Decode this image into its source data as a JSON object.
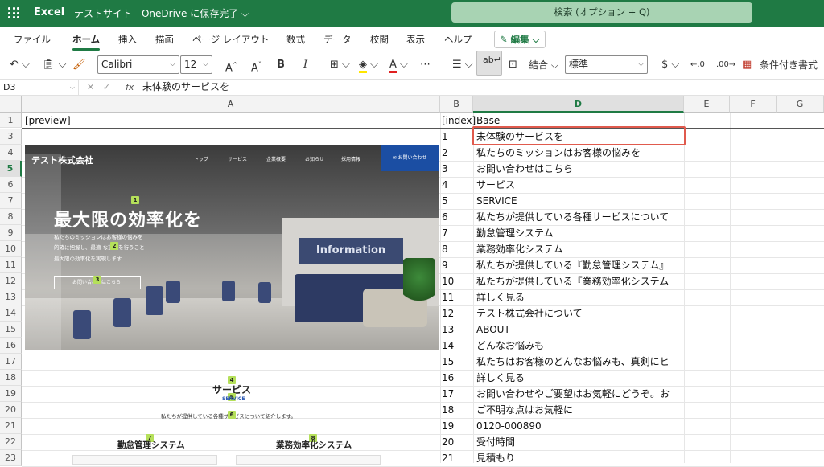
{
  "titlebar": {
    "app": "Excel",
    "doc": "テストサイト - OneDrive に保存完了 ⌵",
    "search_placeholder": "検索 (オプション + Q)"
  },
  "menu": {
    "tabs": [
      "ファイル",
      "ホーム",
      "挿入",
      "描画",
      "ページ レイアウト",
      "数式",
      "データ",
      "校閲",
      "表示",
      "ヘルプ"
    ],
    "edit": "✎ 編集 ⌵"
  },
  "ribbon": {
    "font_name": "Calibri",
    "font_size": "12",
    "number_format": "標準",
    "merge": "結合",
    "currency": "$",
    "conditional": "条件付き書式"
  },
  "formula_bar": {
    "name_box": "D3",
    "formula": "未体験のサービスを"
  },
  "columns": [
    "A",
    "B",
    "D",
    "E",
    "F",
    "G"
  ],
  "rows": [
    "1",
    "3",
    "4",
    "5",
    "6",
    "7",
    "8",
    "9",
    "10",
    "11",
    "12",
    "13",
    "14",
    "15",
    "16",
    "17",
    "18",
    "19",
    "20",
    "21",
    "22",
    "23"
  ],
  "header_row": {
    "a": "[preview]",
    "b": "[index]",
    "d": "Base"
  },
  "table": [
    {
      "index": "1",
      "base": "未体験のサービスを"
    },
    {
      "index": "2",
      "base": "私たちのミッションはお客様の悩みを"
    },
    {
      "index": "3",
      "base": "お問い合わせはこちら"
    },
    {
      "index": "4",
      "base": "サービス"
    },
    {
      "index": "5",
      "base": "SERVICE"
    },
    {
      "index": "6",
      "base": "私たちが提供している各種サービスについて"
    },
    {
      "index": "7",
      "base": "勤怠管理システム"
    },
    {
      "index": "8",
      "base": "業務効率化システム"
    },
    {
      "index": "9",
      "base": "私たちが提供している『勤怠管理システム』"
    },
    {
      "index": "10",
      "base": "私たちが提供している『業務効率化システム"
    },
    {
      "index": "11",
      "base": "詳しく見る"
    },
    {
      "index": "12",
      "base": "テスト株式会社について"
    },
    {
      "index": "13",
      "base": "ABOUT"
    },
    {
      "index": "14",
      "base": "どんなお悩みも"
    },
    {
      "index": "15",
      "base": "私たちはお客様のどんなお悩みも、真剣にヒ"
    },
    {
      "index": "16",
      "base": "詳しく見る"
    },
    {
      "index": "17",
      "base": "お問い合わせやご要望はお気軽にどうぞ。お"
    },
    {
      "index": "18",
      "base": "ご不明な点はお気軽に"
    },
    {
      "index": "19",
      "base": "0120-000890"
    },
    {
      "index": "20",
      "base": "受付時間"
    },
    {
      "index": "21",
      "base": "見積もり"
    }
  ],
  "preview": {
    "company": "テスト株式会社",
    "nav": [
      "トップ",
      "サービス",
      "企業概要",
      "お知らせ",
      "採用情報"
    ],
    "contact": "✉ お問い合わせ",
    "hero": "最大限の効率化を",
    "sub1": "私たちのミッションはお客様の悩みを",
    "sub2": "的確に把握し、最適 な提案を行うこと",
    "sub3": "最大限の効率化を実現します",
    "cta": "お問い合わせはこちら",
    "board": "Information",
    "section_title": "サービス",
    "section_sub": "SERVICE",
    "section_desc": "私たちが提供している各種サービスについて紹介します。",
    "svc1": "勤怠管理システム",
    "svc2": "業務効率化システム",
    "badges": [
      "1",
      "2",
      "3",
      "4",
      "5",
      "6",
      "7",
      "8"
    ]
  }
}
